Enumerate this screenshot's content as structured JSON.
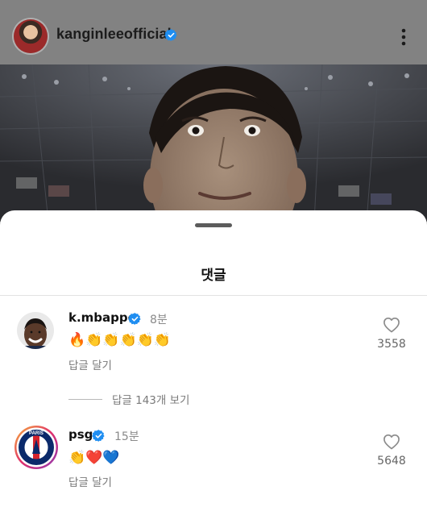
{
  "post": {
    "username": "kanginleeofficial",
    "verified": true,
    "more_icon": "more-vertical-icon"
  },
  "sheet": {
    "title": "댓글"
  },
  "comments": [
    {
      "username": "k.mbappe",
      "verified": true,
      "time": "8분",
      "emojis": "🔥👏👏👏👏👏",
      "reply_label": "답글 달기",
      "likes": "3558",
      "view_replies": "답글 143개 보기"
    },
    {
      "username": "psg",
      "verified": true,
      "time": "15분",
      "emojis": "👏❤️💙",
      "reply_label": "답글 달기",
      "likes": "5648"
    }
  ],
  "colors": {
    "verified_blue": "#1f8ef1",
    "psg_navy": "#0b2a6b",
    "psg_red": "#d6232c"
  }
}
